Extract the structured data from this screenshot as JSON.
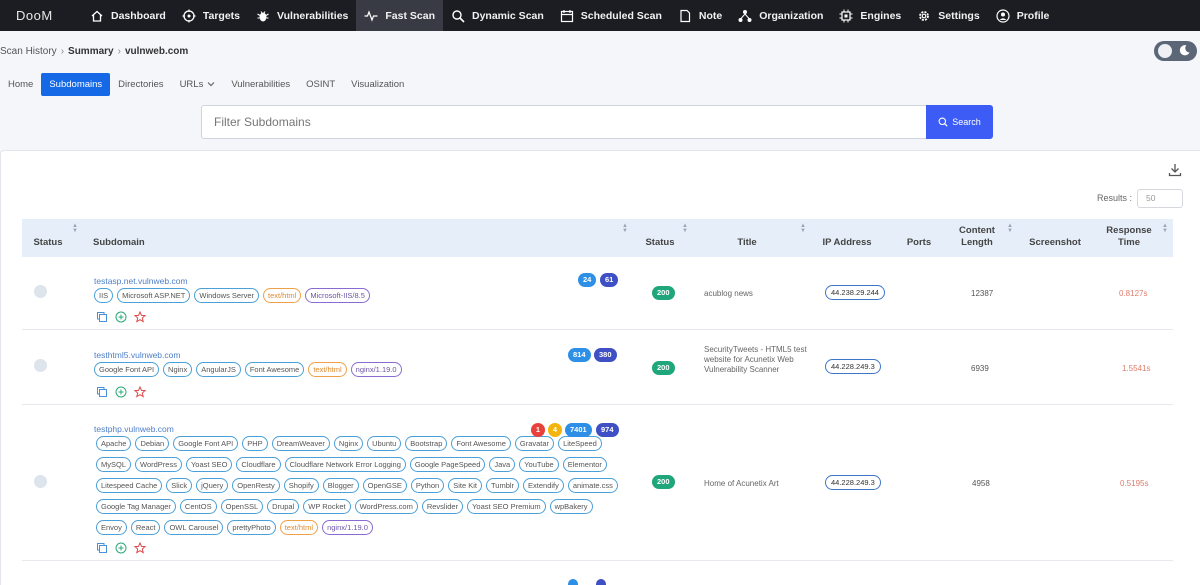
{
  "app": {
    "brand": "DooM"
  },
  "nav": [
    {
      "label": "Dashboard",
      "icon": "home-icon"
    },
    {
      "label": "Targets",
      "icon": "target-icon"
    },
    {
      "label": "Vulnerabilities",
      "icon": "bug-icon"
    },
    {
      "label": "Fast Scan",
      "icon": "pulse-icon",
      "active": true
    },
    {
      "label": "Dynamic Scan",
      "icon": "search-icon"
    },
    {
      "label": "Scheduled Scan",
      "icon": "calendar-icon"
    },
    {
      "label": "Note",
      "icon": "note-icon"
    },
    {
      "label": "Organization",
      "icon": "organization-icon"
    },
    {
      "label": "Engines",
      "icon": "cpu-icon"
    },
    {
      "label": "Settings",
      "icon": "gear-icon"
    },
    {
      "label": "Profile",
      "icon": "user-icon"
    }
  ],
  "breadcrumb": {
    "c1": "Scan History",
    "c2": "Summary",
    "c3": "vulnweb.com"
  },
  "tabs": [
    "Home",
    "Subdomains",
    "Directories",
    "URLs",
    "Vulnerabilities",
    "OSINT",
    "Visualization"
  ],
  "active_tab": "Subdomains",
  "search": {
    "placeholder": "Filter Subdomains",
    "button": "Search"
  },
  "results": {
    "label": "Results :",
    "value": "50"
  },
  "table": {
    "headers": {
      "status": "Status",
      "subdomain": "Subdomain",
      "http_status": "Status",
      "title": "Title",
      "ip": "IP Address",
      "ports": "Ports",
      "content_length": "Content Length",
      "screenshot": "Screenshot",
      "response_time": "Response Time"
    },
    "rows": [
      {
        "subdomain": "testasp.net.vulnweb.com",
        "counts": [
          "24",
          "61"
        ],
        "tech": [
          "IIS",
          "Microsoft ASP.NET",
          "Windows Server",
          "text/html",
          "Microsoft-IIS/8.5"
        ],
        "status": "200",
        "title": "acublog news",
        "ip": "44.238.29.244",
        "content_length": "12387",
        "response_time": "0.8127s"
      },
      {
        "subdomain": "testhtml5.vulnweb.com",
        "counts": [
          "814",
          "380"
        ],
        "tech": [
          "Google Font API",
          "Nginx",
          "AngularJS",
          "Font Awesome",
          "text/html",
          "nginx/1.19.0"
        ],
        "status": "200",
        "title": "SecurityTweets - HTML5 test website for Acunetix Web Vulnerability Scanner",
        "ip": "44.228.249.3",
        "content_length": "6939",
        "response_time": "1.5541s"
      },
      {
        "subdomain": "testphp.vulnweb.com",
        "counts": [
          "1",
          "4",
          "7401",
          "974"
        ],
        "tech": [
          "Apache",
          "Debian",
          "Google Font API",
          "PHP",
          "DreamWeaver",
          "Nginx",
          "Ubuntu",
          "Bootstrap",
          "Font Awesome",
          "Gravatar",
          "LiteSpeed",
          "MySQL",
          "WordPress",
          "Yoast SEO",
          "Cloudflare",
          "Cloudflare Network Error Logging",
          "Google PageSpeed",
          "Java",
          "YouTube",
          "Elementor",
          "Litespeed Cache",
          "Slick",
          "jQuery",
          "OpenResty",
          "Shopify",
          "Blogger",
          "OpenGSE",
          "Python",
          "Site Kit",
          "Tumblr",
          "Extendify",
          "animate.css",
          "Google Tag Manager",
          "CentOS",
          "OpenSSL",
          "Drupal",
          "WP Rocket",
          "WordPress.com",
          "Revslider",
          "Yoast SEO Premium",
          "wpBakery",
          "Envoy",
          "React",
          "OWL Carousel",
          "prettyPhoto",
          "text/html",
          "nginx/1.19.0"
        ],
        "status": "200",
        "title": "Home of Acunetix Art",
        "ip": "44.228.249.3",
        "content_length": "4958",
        "response_time": "0.5195s"
      }
    ]
  },
  "colors": {
    "nav_bg": "#1b1d22",
    "primary": "#1569e6",
    "search_button": "#3d5cf5",
    "status_green": "#1fa67a"
  }
}
